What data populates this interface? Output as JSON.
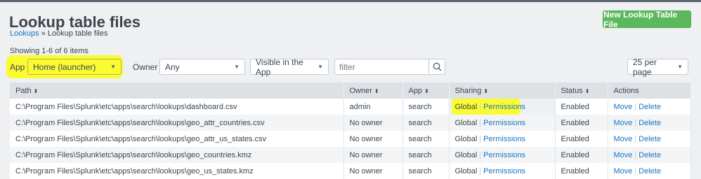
{
  "header": {
    "title": "Lookup table files",
    "breadcrumb_link": "Lookups",
    "breadcrumb_sep": "»",
    "breadcrumb_current": "Lookup table files",
    "new_button": "New Lookup Table File",
    "showing": "Showing 1-6 of 6 items"
  },
  "filters": {
    "app_label": "App",
    "app_value": "Home (launcher)",
    "owner_label": "Owner",
    "owner_value": "Any",
    "visibility_value": "Visible in the App",
    "filter_placeholder": "filter",
    "per_page": "25 per page"
  },
  "table": {
    "columns": [
      "Path",
      "Owner",
      "App",
      "Sharing",
      "Status",
      "Actions"
    ],
    "rows": [
      {
        "path": "C:\\Program Files\\Splunk\\etc\\apps\\search\\lookups\\dashboard.csv",
        "owner": "admin",
        "app": "search",
        "sharing": "Global",
        "permissions": "Permissions",
        "status": "Enabled",
        "move": "Move",
        "delete": "Delete"
      },
      {
        "path": "C:\\Program Files\\Splunk\\etc\\apps\\search\\lookups\\geo_attr_countries.csv",
        "owner": "No owner",
        "app": "search",
        "sharing": "Global",
        "permissions": "Permissions",
        "status": "Enabled",
        "move": "Move",
        "delete": "Delete"
      },
      {
        "path": "C:\\Program Files\\Splunk\\etc\\apps\\search\\lookups\\geo_attr_us_states.csv",
        "owner": "No owner",
        "app": "search",
        "sharing": "Global",
        "permissions": "Permissions",
        "status": "Enabled",
        "move": "Move",
        "delete": "Delete"
      },
      {
        "path": "C:\\Program Files\\Splunk\\etc\\apps\\search\\lookups\\geo_countries.kmz",
        "owner": "No owner",
        "app": "search",
        "sharing": "Global",
        "permissions": "Permissions",
        "status": "Enabled",
        "move": "Move",
        "delete": "Delete"
      },
      {
        "path": "C:\\Program Files\\Splunk\\etc\\apps\\search\\lookups\\geo_us_states.kmz",
        "owner": "No owner",
        "app": "search",
        "sharing": "Global",
        "permissions": "Permissions",
        "status": "Enabled",
        "move": "Move",
        "delete": "Delete"
      }
    ]
  },
  "colors": {
    "accent": "#1a76c2",
    "button_green": "#5cb85c",
    "highlight": "#fbfb33"
  }
}
